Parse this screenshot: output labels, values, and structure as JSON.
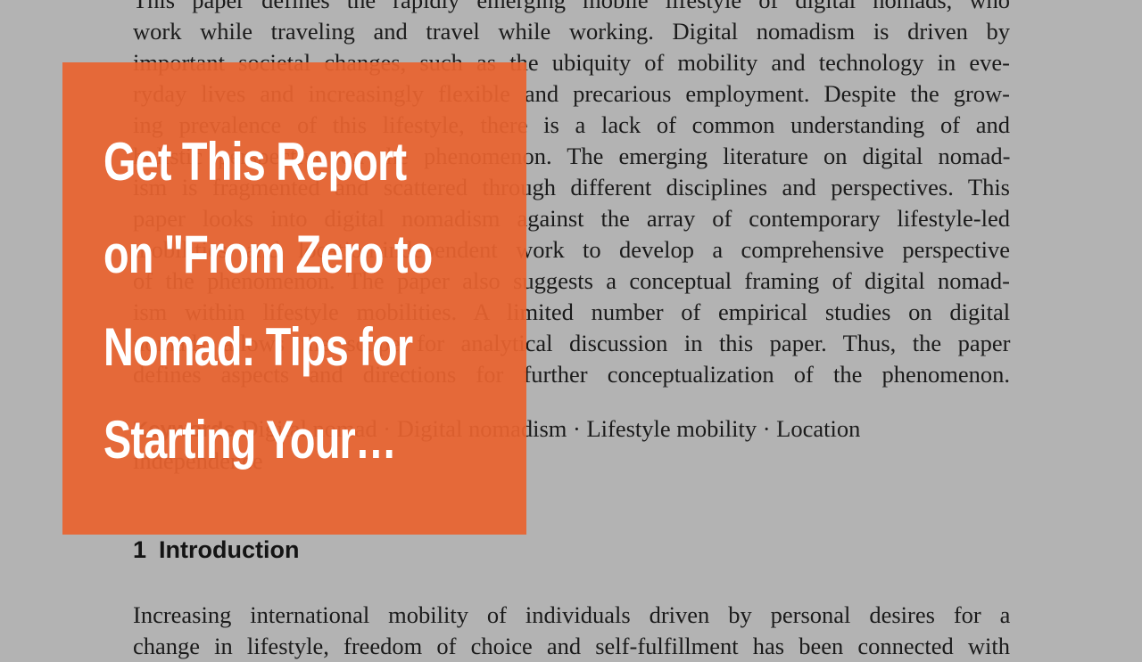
{
  "document": {
    "abstract_lines": [
      "This paper defines the rapidly emerging mobile lifestyle of digital nomads, who",
      "work while traveling and travel while working. Digital nomadism is driven by",
      "important societal changes, such as the ubiquity of mobility and technology in eve-",
      "ryday lives and increasingly flexible and precarious employment. Despite the grow-",
      "ing prevalence of this lifestyle, there is a lack of common understanding of and",
      "holistic perspective on the phenomenon. The emerging literature on digital nomad-",
      "ism is fragmented and scattered  through different disciplines and perspectives. This",
      "paper looks into digital nomadism against the array of contemporary lifestyle-led",
      "mobilities and location-independent work to develop a comprehensive perspective",
      "of the phenomenon. The paper also suggests a conceptual framing of digital nomad-",
      "ism within lifestyle mobilities. A limited number of empirical studies on digital",
      "nomads allows the scope for analytical discussion in this paper. Thus, the paper",
      "defines aspects and directions for further conceptualization of the phenomenon."
    ],
    "keywords_label": "Keywords",
    "keywords_line1": "Digital nomad · Digital nomadism · Lifestyle mobility · Location",
    "keywords_line2": "independence",
    "section_number": "1",
    "section_title": "Introduction",
    "intro_lines": [
      "Increasing international mobility of individuals driven by personal desires for a",
      "change in lifestyle, freedom of choice and self-fulfillment has been connected with"
    ]
  },
  "overlay": {
    "title_lines": [
      "Get This Report",
      "on \"From Zero to",
      "Nomad: Tips for",
      "Starting Your…"
    ],
    "color": "#e8632f"
  }
}
